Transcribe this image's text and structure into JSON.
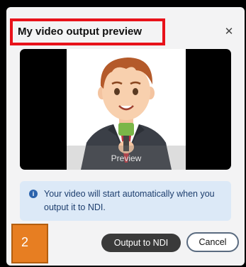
{
  "dialog": {
    "title": "My video output preview",
    "close_icon": "close-icon"
  },
  "preview": {
    "label": "Preview",
    "image": "cartoon-reporter-with-microphone"
  },
  "info": {
    "icon": "info-icon",
    "icon_glyph": "i",
    "message": "Your video will start automatically when you output it to NDI."
  },
  "annotation": {
    "badge_text": "2"
  },
  "actions": {
    "primary_label": "Output to NDI",
    "cancel_label": "Cancel"
  },
  "colors": {
    "highlight_border": "#e8121a",
    "info_background": "#dce9f7",
    "info_icon": "#2b63ad",
    "badge_fill": "#e77e22",
    "primary_button": "#3a3a3a"
  }
}
